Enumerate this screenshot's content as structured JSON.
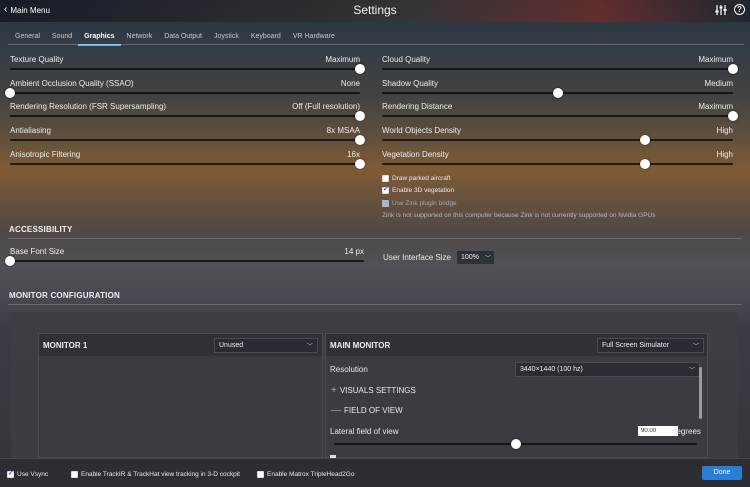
{
  "header": {
    "back_label": "Main Menu",
    "title": "Settings",
    "icons": [
      "sliders-icon",
      "help-icon"
    ]
  },
  "tabs": [
    {
      "label": "General",
      "active": false
    },
    {
      "label": "Sound",
      "active": false
    },
    {
      "label": "Graphics",
      "active": true
    },
    {
      "label": "Network",
      "active": false
    },
    {
      "label": "Data Output",
      "active": false
    },
    {
      "label": "Joystick",
      "active": false
    },
    {
      "label": "Keyboard",
      "active": false
    },
    {
      "label": "VR Hardware",
      "active": false
    }
  ],
  "graphics_left": [
    {
      "label": "Texture Quality",
      "value": "Maximum",
      "level": 1.0
    },
    {
      "label": "Ambient Occlusion Quality (SSAO)",
      "value": "None",
      "level": 0.0
    },
    {
      "label": "Rendering Resolution (FSR Supersampling)",
      "value": "Off (Full resolution)",
      "level": 1.0
    },
    {
      "label": "Antialiasing",
      "value": "8x MSAA",
      "level": 1.0
    },
    {
      "label": "Anisotropic Filtering",
      "value": "16x",
      "level": 1.0
    }
  ],
  "graphics_right": [
    {
      "label": "Cloud Quality",
      "value": "Maximum",
      "level": 1.0
    },
    {
      "label": "Shadow Quality",
      "value": "Medium",
      "level": 0.5
    },
    {
      "label": "Rendering Distance",
      "value": "Maximum",
      "level": 1.0
    },
    {
      "label": "World Objects Density",
      "value": "High",
      "level": 0.75
    },
    {
      "label": "Vegetation Density",
      "value": "High",
      "level": 0.75
    }
  ],
  "checkboxes": {
    "draw_parked": {
      "label": "Draw parked aircraft",
      "checked": false
    },
    "enable_3d_veg": {
      "label": "Enable 3D vegetation",
      "checked": true
    },
    "zink": {
      "label": "Use Zink plugin bridge",
      "checked": false,
      "disabled": true
    }
  },
  "zink_note": "Zink is not supported on this computer because Zink is not currently supported on Nvidia GPUs",
  "accessibility": {
    "heading": "ACCESSIBILITY",
    "base_font_label": "Base Font Size",
    "base_font_value": "14 px",
    "base_font_level": 0.0,
    "ui_size_label": "User Interface Size",
    "ui_size_value": "100%"
  },
  "monitor_config": {
    "heading": "MONITOR CONFIGURATION",
    "monitor1": {
      "title": "MONITOR 1",
      "mode": "Unused"
    },
    "main": {
      "title": "MAIN MONITOR",
      "mode": "Full Screen Simulator",
      "resolution_label": "Resolution",
      "resolution_value": "3440×1440 (100 hz)",
      "visuals_label": "VISUALS SETTINGS",
      "visuals_icon": "plus-icon",
      "fov_section_label": "FIELD OF VIEW",
      "fov_section_icon": "minus-icon",
      "lateral_fov_label": "Lateral field of view",
      "lateral_fov_value": "90.00",
      "lateral_fov_unit": "degrees",
      "lateral_fov_level": 0.5
    }
  },
  "bottom": {
    "use_vsync": {
      "label": "Use Vsync",
      "checked": true
    },
    "trackir": {
      "label": "Enable TrackIR & TrackHat view tracking in 3-D cockpit",
      "checked": false
    },
    "matrox": {
      "label": "Enable Matrox TripleHead2Go",
      "checked": false
    },
    "done_label": "Done"
  },
  "colors": {
    "accent": "#2a7fd4",
    "tab_underline": "#5cb8e6"
  }
}
